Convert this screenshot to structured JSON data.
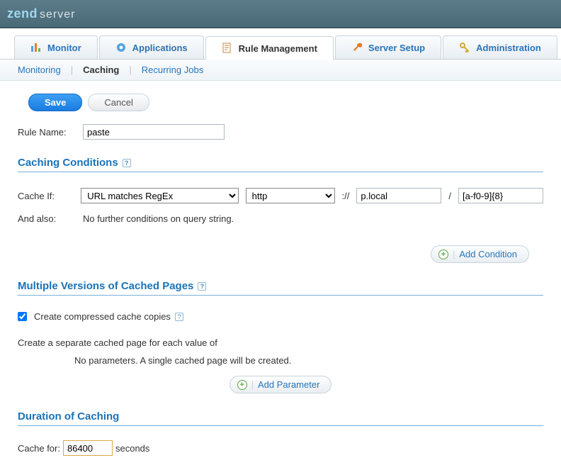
{
  "header": {
    "brand1": "zend",
    "brand2": "server"
  },
  "tabs": {
    "monitor": "Monitor",
    "applications": "Applications",
    "rule_management": "Rule Management",
    "server_setup": "Server Setup",
    "administration": "Administration"
  },
  "subnav": {
    "monitoring": "Monitoring",
    "caching": "Caching",
    "recurring": "Recurring Jobs"
  },
  "buttons": {
    "save": "Save",
    "cancel": "Cancel"
  },
  "rule": {
    "label": "Rule Name:",
    "value": "paste"
  },
  "sections": {
    "caching_conditions": "Caching Conditions",
    "multiple_versions": "Multiple Versions of Cached Pages",
    "duration": "Duration of Caching"
  },
  "cache_if": {
    "label": "Cache If:",
    "match_mode": "URL matches RegEx",
    "protocol": "http",
    "scheme_sep": "://",
    "host": "p.local",
    "path_sep": "/",
    "path": "[a-f0-9]{8}"
  },
  "also": {
    "label": "And also:",
    "text": "No further conditions on query string."
  },
  "add_condition": "Add Condition",
  "compressed": {
    "label": "Create compressed cache copies",
    "checked": true
  },
  "separate": {
    "text": "Create a separate cached page for each value of",
    "sub": "No parameters. A single cached page will be created."
  },
  "add_parameter": "Add Parameter",
  "duration": {
    "label": "Cache for:",
    "value": "86400",
    "unit": "seconds"
  },
  "help_glyph": "?"
}
